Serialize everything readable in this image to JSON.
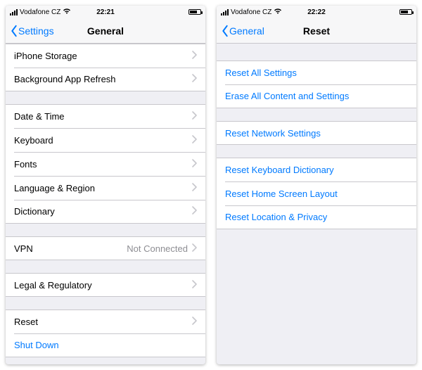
{
  "left": {
    "carrier": "Vodafone CZ",
    "time": "22:21",
    "back": "Settings",
    "title": "General",
    "groups": [
      {
        "rows": [
          {
            "label": "iPhone Storage",
            "chevron": true
          },
          {
            "label": "Background App Refresh",
            "chevron": true
          }
        ]
      },
      {
        "rows": [
          {
            "label": "Date & Time",
            "chevron": true
          },
          {
            "label": "Keyboard",
            "chevron": true
          },
          {
            "label": "Fonts",
            "chevron": true
          },
          {
            "label": "Language & Region",
            "chevron": true
          },
          {
            "label": "Dictionary",
            "chevron": true
          }
        ]
      },
      {
        "rows": [
          {
            "label": "VPN",
            "detail": "Not Connected",
            "chevron": true
          }
        ]
      },
      {
        "rows": [
          {
            "label": "Legal & Regulatory",
            "chevron": true
          }
        ]
      },
      {
        "rows": [
          {
            "label": "Reset",
            "chevron": true
          },
          {
            "label": "Shut Down",
            "action": true
          }
        ]
      }
    ]
  },
  "right": {
    "carrier": "Vodafone CZ",
    "time": "22:22",
    "back": "General",
    "title": "Reset",
    "groups": [
      {
        "rows": [
          {
            "label": "Reset All Settings",
            "action": true
          },
          {
            "label": "Erase All Content and Settings",
            "action": true
          }
        ]
      },
      {
        "rows": [
          {
            "label": "Reset Network Settings",
            "action": true
          }
        ]
      },
      {
        "rows": [
          {
            "label": "Reset Keyboard Dictionary",
            "action": true
          },
          {
            "label": "Reset Home Screen Layout",
            "action": true
          },
          {
            "label": "Reset Location & Privacy",
            "action": true
          }
        ]
      }
    ]
  }
}
